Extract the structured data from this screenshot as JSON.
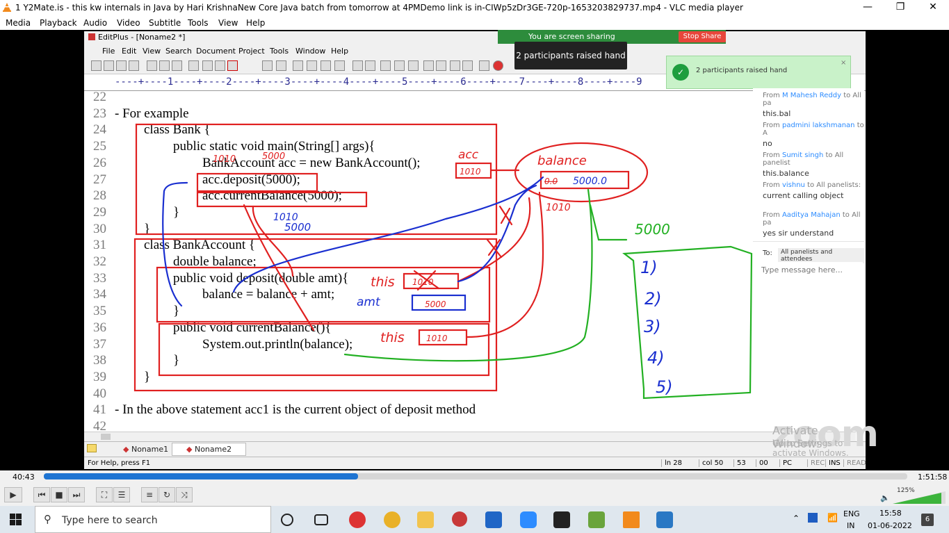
{
  "window": {
    "title": "1 Y2Mate.is - this kw internals in Java by Hari KrishnaNew Core Java batch from tomorrow at 4PMDemo link is in-CIWp5zDr3GE-720p-1653203829737.mp4 - VLC media player",
    "minimize": "—",
    "restore": "❐",
    "close": "✕"
  },
  "menu": [
    "Media",
    "Playback",
    "Audio",
    "Video",
    "Subtitle",
    "Tools",
    "View",
    "Help"
  ],
  "editplus": {
    "title": "EditPlus - [Noname2 *]",
    "menu": [
      "File",
      "Edit",
      "View",
      "Search",
      "Document",
      "Project",
      "Tools",
      "Window",
      "Help"
    ],
    "ruler": "----+----1----+----2----+----3----+----4----+----5----+----6----+----7----+----8----+----9",
    "lines": [
      {
        "n": "22",
        "t": ""
      },
      {
        "n": "23",
        "t": "- For example"
      },
      {
        "n": "24",
        "t": "class Bank {"
      },
      {
        "n": "25",
        "t": "public static void main(String[] args){"
      },
      {
        "n": "26",
        "t": "BankAccount acc = new BankAccount();"
      },
      {
        "n": "27",
        "t": "acc.deposit(5000);"
      },
      {
        "n": "28",
        "t": "acc.currentBalance(5000);"
      },
      {
        "n": "29",
        "t": "}"
      },
      {
        "n": "30",
        "t": "}"
      },
      {
        "n": "31",
        "t": "class BankAccount {"
      },
      {
        "n": "32",
        "t": "double balance;"
      },
      {
        "n": "33",
        "t": "public void deposit(double amt){"
      },
      {
        "n": "34",
        "t": "balance = balance + amt;"
      },
      {
        "n": "35",
        "t": "}"
      },
      {
        "n": "36",
        "t": "public void currentBalance(){"
      },
      {
        "n": "37",
        "t": "System.out.println(balance);"
      },
      {
        "n": "38",
        "t": "}"
      },
      {
        "n": "39",
        "t": "}"
      },
      {
        "n": "40",
        "t": ""
      },
      {
        "n": "41",
        "t": "- In the above statement acc1 is the current object of deposit method"
      },
      {
        "n": "42",
        "t": ""
      }
    ],
    "tabs": [
      "Noname1",
      "Noname2"
    ],
    "status": {
      "help": "For Help, press F1",
      "ln": "ln 28",
      "col": "col 50",
      "num": "53",
      "code": "00",
      "pc": "PC",
      "rec": "REC",
      "ins": "INS",
      "read": "READ"
    }
  },
  "annotations": {
    "acc": "acc",
    "acc_val": "1010",
    "balance": "balance",
    "bal_old": "0.0",
    "bal_new": "5000.0",
    "addr": "1010",
    "n1010": "1010",
    "n5000": "5000",
    "n1010b": "1010",
    "n5000b": "5000",
    "this1": "this",
    "this1_val": "1010",
    "amt": "amt",
    "amt_val": "5000",
    "this2": "this",
    "this2_val": "1010",
    "green5000": "5000",
    "list": [
      "1)",
      "2)",
      "3)",
      "4)",
      "5)"
    ]
  },
  "zoom": {
    "share": "You are screen sharing",
    "stop": "Stop Share",
    "tooltip": "2 participants raised hand",
    "notif": "2 participants raised hand",
    "chat": [
      {
        "from": "From",
        "name": "M Mahesh Reddy",
        "to": "to All pa",
        "msg": "this.bal"
      },
      {
        "from": "From",
        "name": "padmini lakshmanan",
        "to": "to A",
        "msg": "no"
      },
      {
        "from": "From",
        "name": "Sumit singh",
        "to": "to All panelist",
        "msg": "this.balance"
      },
      {
        "from": "From",
        "name": "vishnu",
        "to": "to All panelists:",
        "msg": "current calling object"
      },
      {
        "from": "From",
        "name": "Aaditya Mahajan",
        "to": "to All pa",
        "msg": "yes sir understand"
      }
    ],
    "to_label": "To:",
    "to_value": "All panelists and attendees",
    "placeholder": "Type message here...",
    "watermark": "zoom",
    "activate": "Activate Windows",
    "activate2": "Go to Settings to activate Windows."
  },
  "player": {
    "elapsed": "40:43",
    "total": "1:51:58",
    "progress": 0.364,
    "volume": "125%"
  },
  "taskbar": {
    "search": "Type here to search",
    "lang": "ENG",
    "lang2": "IN",
    "time": "15:58",
    "date": "01-06-2022",
    "notif": "6"
  }
}
